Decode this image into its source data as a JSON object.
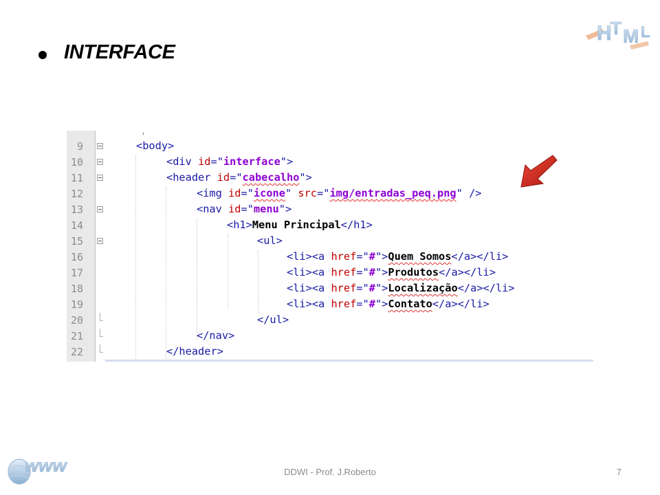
{
  "slide": {
    "title": "INTERFACE",
    "footer": "DDWI - Prof. J.Roberto",
    "page_number": "7"
  },
  "logos": {
    "top_right_text": "HTML",
    "bottom_left_text": "www"
  },
  "editor": {
    "lines": [
      {
        "num": "9",
        "indent": 1,
        "fold": "open"
      },
      {
        "num": "10",
        "indent": 2,
        "fold": "open"
      },
      {
        "num": "11",
        "indent": 2,
        "fold": "open"
      },
      {
        "num": "12",
        "indent": 3,
        "fold": "none"
      },
      {
        "num": "13",
        "indent": 3,
        "fold": "open"
      },
      {
        "num": "14",
        "indent": 4,
        "fold": "none"
      },
      {
        "num": "15",
        "indent": 5,
        "fold": "open"
      },
      {
        "num": "16",
        "indent": 6,
        "fold": "none"
      },
      {
        "num": "17",
        "indent": 6,
        "fold": "none"
      },
      {
        "num": "18",
        "indent": 6,
        "fold": "none"
      },
      {
        "num": "19",
        "indent": 6,
        "fold": "none"
      },
      {
        "num": "20",
        "indent": 5,
        "fold": "end"
      },
      {
        "num": "21",
        "indent": 3,
        "fold": "end"
      },
      {
        "num": "22",
        "indent": 2,
        "fold": "end"
      }
    ],
    "code": {
      "l9": {
        "open": "<body>"
      },
      "l10": {
        "tag": "<div ",
        "attr": "id",
        "eq": "=\"",
        "val": "interface",
        "close": "\">"
      },
      "l11": {
        "tag": "<header ",
        "attr": "id",
        "eq": "=\"",
        "val": "cabecalho",
        "close": "\">"
      },
      "l12": {
        "tag": "<img ",
        "attr1": "id",
        "eq1": "=\"",
        "val1": "icone",
        "q1": "\" ",
        "attr2": "src",
        "eq2": "=\"",
        "val2": "img/entradas_peq.png",
        "close": "\" />"
      },
      "l13": {
        "tag": "<nav ",
        "attr": "id",
        "eq": "=\"",
        "val": "menu",
        "close": "\">"
      },
      "l14": {
        "open": "<h1>",
        "text1": "Menu",
        "space": " ",
        "text2": "Principal",
        "close": "</h1>"
      },
      "l15": {
        "open": "<ul>"
      },
      "l16": {
        "pre": "<li><a ",
        "attr": "href",
        "eq": "=\"",
        "val": "#",
        "mid": "\">",
        "text": "Quem Somos",
        "close": "</a></li>"
      },
      "l17": {
        "pre": "<li><a ",
        "attr": "href",
        "eq": "=\"",
        "val": "#",
        "mid": "\">",
        "text": "Produtos",
        "close": "</a></li>"
      },
      "l18": {
        "pre": "<li><a ",
        "attr": "href",
        "eq": "=\"",
        "val": "#",
        "mid": "\">",
        "text": "Localização",
        "close": "</a></li>"
      },
      "l19": {
        "pre": "<li><a ",
        "attr": "href",
        "eq": "=\"",
        "val": "#",
        "mid": "\">",
        "text": "Contato",
        "close": "</a></li>"
      },
      "l20": {
        "open": "</ul>"
      },
      "l21": {
        "open": "</nav>"
      },
      "l22": {
        "open": "</header>"
      }
    }
  },
  "colors": {
    "tag": "#1a1aa6",
    "attribute": "#c00000",
    "string": "#8c00d4",
    "arrow": "#d42b20"
  }
}
